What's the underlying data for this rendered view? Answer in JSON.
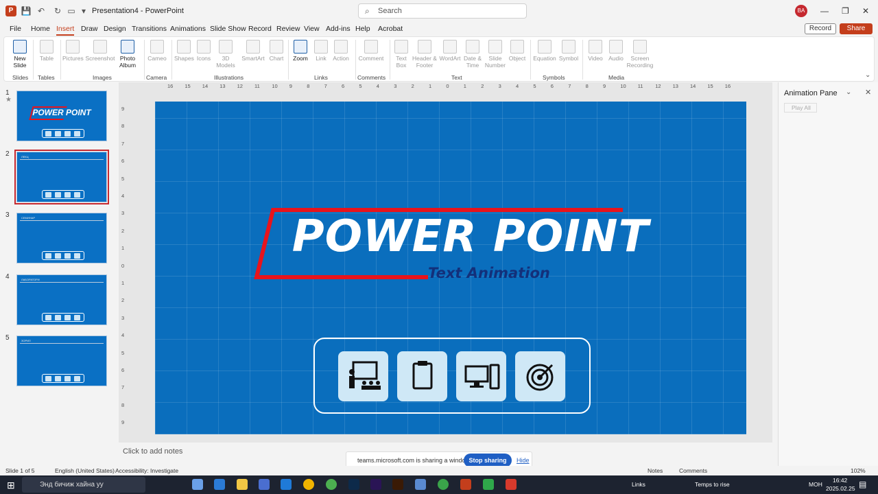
{
  "window": {
    "title": "Presentation4 - PowerPoint",
    "search_placeholder": "Search",
    "avatar": "BA"
  },
  "menu": {
    "tabs": [
      "File",
      "Home",
      "Insert",
      "Draw",
      "Design",
      "Transitions",
      "Animations",
      "Slide Show",
      "Record",
      "Review",
      "View",
      "Add-ins",
      "Help",
      "Acrobat"
    ],
    "active": "Insert",
    "record": "Record",
    "share": "Share"
  },
  "ribbon": {
    "new_slide": "New Slide",
    "table": "Table",
    "pictures": "Pictures",
    "screenshot": "Screenshot",
    "photo_album": "Photo Album",
    "cameo": "Cameo",
    "shapes": "Shapes",
    "icons": "Icons",
    "models_3d": "3D Models",
    "smartart": "SmartArt",
    "chart": "Chart",
    "zoom": "Zoom",
    "link": "Link",
    "action": "Action",
    "comment": "Comment",
    "text_box": "Text Box",
    "header_footer": "Header & Footer",
    "wordart": "WordArt",
    "date_time": "Date & Time",
    "slide_number": "Slide Number",
    "object": "Object",
    "equation": "Equation",
    "symbol": "Symbol",
    "video": "Video",
    "audio": "Audio",
    "screen_recording": "Screen Recording",
    "groups": [
      "Slides",
      "Tables",
      "Images",
      "Camera",
      "Illustrations",
      "Links",
      "Comments",
      "Text",
      "Symbols",
      "Media"
    ]
  },
  "thumbnails": [
    {
      "num": "1",
      "big": "POWER POINT",
      "small": ""
    },
    {
      "num": "2",
      "big": "",
      "small": "ЛЕКЦ"
    },
    {
      "num": "3",
      "big": "",
      "small": "СЕМИНАР"
    },
    {
      "num": "4",
      "big": "",
      "small": "ЛАБОРАТОРИ"
    },
    {
      "num": "5",
      "big": "",
      "small": "ЗОРИЛ"
    }
  ],
  "slide": {
    "title": "POWER POINT",
    "subtitle": "Text Animation"
  },
  "notes_placeholder": "Click to add notes",
  "animation_pane": {
    "title": "Animation Pane",
    "play_all": "Play All"
  },
  "share_banner": {
    "text": "teams.microsoft.com is sharing a window.",
    "stop": "Stop sharing",
    "hide": "Hide"
  },
  "status": {
    "slide_of": "Slide 1 of 5",
    "language": "English (United States)",
    "accessibility": "Accessibility: Investigate",
    "notes": "Notes",
    "comments": "Comments",
    "zoom": "102%"
  },
  "taskbar": {
    "search_placeholder": "Энд бичиж хайна уу",
    "links": "Links",
    "weather": "Temps to rise",
    "lang": "МОН",
    "time": "16:42",
    "date": "2025.02.25"
  },
  "rulers": {
    "horizontal": [
      "16",
      "15",
      "14",
      "13",
      "12",
      "11",
      "10",
      "9",
      "8",
      "7",
      "6",
      "5",
      "4",
      "3",
      "2",
      "1",
      "0",
      "1",
      "2",
      "3",
      "4",
      "5",
      "6",
      "7",
      "8",
      "9",
      "10",
      "11",
      "12",
      "13",
      "14",
      "15",
      "16"
    ],
    "vertical": [
      "9",
      "8",
      "7",
      "6",
      "5",
      "4",
      "3",
      "2",
      "1",
      "0",
      "1",
      "2",
      "3",
      "4",
      "5",
      "6",
      "7",
      "8",
      "9"
    ]
  },
  "colors": {
    "accent": "#c43e1c",
    "slide_bg": "#0a6ebd",
    "subtitle": "#13307a",
    "frame_red": "#e8141c"
  }
}
